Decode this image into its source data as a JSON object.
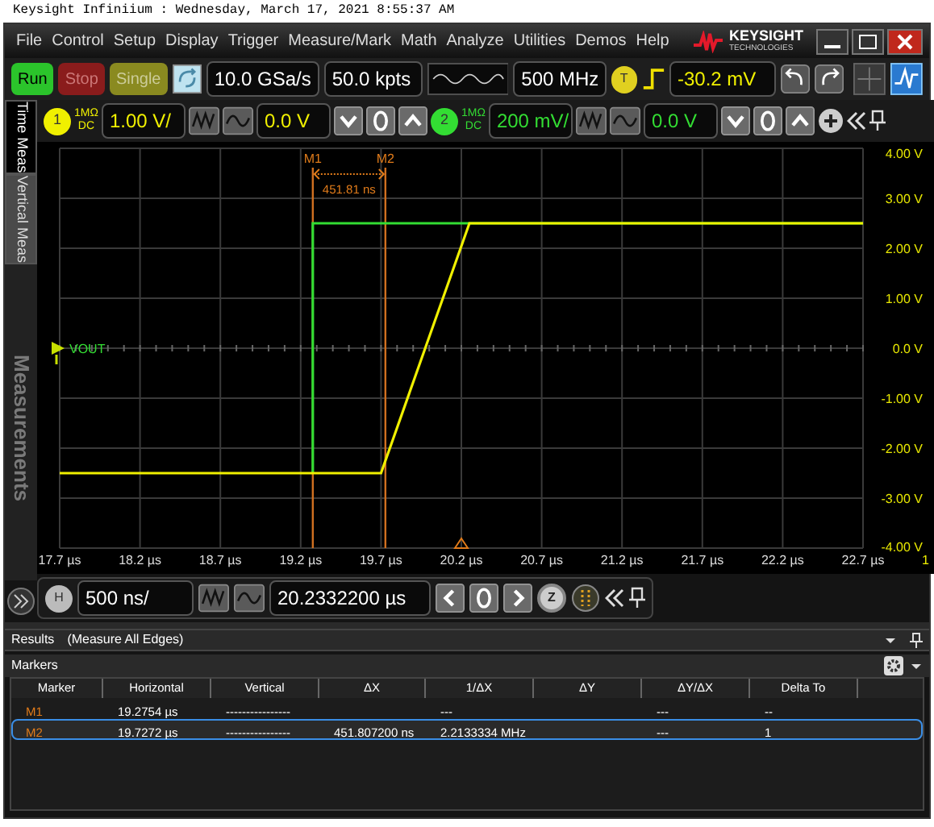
{
  "title_line": "Keysight Infiniium : Wednesday, March 17, 2021 8:55:37 AM",
  "menu": [
    "File",
    "Control",
    "Setup",
    "Display",
    "Trigger",
    "Measure/Mark",
    "Math",
    "Analyze",
    "Utilities",
    "Demos",
    "Help"
  ],
  "logo": {
    "name": "KEYSIGHT",
    "sub": "TECHNOLOGIES"
  },
  "toolbar": {
    "run": "Run",
    "stop": "Stop",
    "single": "Single",
    "sample_rate": "10.0 GSa/s",
    "memory": "50.0 kpts",
    "bandwidth": "500 MHz",
    "trigger_badge": "T",
    "trigger_level": "-30.2 mV"
  },
  "channels": [
    {
      "number": "1",
      "impedance": "1MΩ",
      "coupling": "DC",
      "scale": "1.00 V/",
      "offset": "0.0 V",
      "color": "#f0f000"
    },
    {
      "number": "2",
      "impedance": "1MΩ",
      "coupling": "DC",
      "scale": "200 mV/",
      "offset": "0.0 V",
      "color": "#33dd33"
    }
  ],
  "side_tabs": [
    {
      "label": "Time Meas",
      "selected": true
    },
    {
      "label": "Vertical Meas",
      "selected": false
    }
  ],
  "side_panel_label": "Measurements",
  "plot": {
    "channel_label": "VOUT",
    "delta_label": "451.81 ns",
    "edge_label": "1",
    "chart_data": {
      "type": "line",
      "grid": true,
      "x": [
        17.7,
        19.2754,
        19.2755,
        19.7,
        20.25,
        22.7
      ],
      "series": [
        {
          "color": "#33dd33",
          "values": [
            null,
            -2.5,
            2.5,
            2.5,
            2.5,
            2.5
          ]
        },
        {
          "color": "#f0f000",
          "values": [
            -2.5,
            -2.5,
            -2.5,
            -2.5,
            2.5,
            2.5
          ]
        }
      ],
      "ref_lines": [
        {
          "axis": "x",
          "value": 19.2754,
          "label": "M1",
          "color": "#d07020"
        },
        {
          "axis": "x",
          "value": 19.7272,
          "label": "M2",
          "color": "#d07020"
        }
      ],
      "xlim": [
        17.7,
        22.7
      ],
      "ylim": [
        -4,
        4
      ],
      "xticks": [
        {
          "value": 17.7,
          "label": "17.7 µs"
        },
        {
          "value": 18.2,
          "label": "18.2 µs"
        },
        {
          "value": 18.7,
          "label": "18.7 µs"
        },
        {
          "value": 19.2,
          "label": "19.2 µs"
        },
        {
          "value": 19.7,
          "label": "19.7 µs"
        },
        {
          "value": 20.2,
          "label": "20.2 µs"
        },
        {
          "value": 20.7,
          "label": "20.7 µs"
        },
        {
          "value": 21.2,
          "label": "21.2 µs"
        },
        {
          "value": 21.7,
          "label": "21.7 µs"
        },
        {
          "value": 22.2,
          "label": "22.2 µs"
        },
        {
          "value": 22.7,
          "label": "22.7 µs"
        }
      ],
      "yticks": [
        {
          "value": 4,
          "label": "4.00 V"
        },
        {
          "value": 3,
          "label": "3.00 V"
        },
        {
          "value": 2,
          "label": "2.00 V"
        },
        {
          "value": 1,
          "label": "1.00 V"
        },
        {
          "value": 0,
          "label": "0.0 V"
        },
        {
          "value": -1,
          "label": "-1.00 V"
        },
        {
          "value": -2,
          "label": "-2.00 V"
        },
        {
          "value": -3,
          "label": "-3.00 V"
        },
        {
          "value": -4,
          "label": "-4.00 V"
        }
      ]
    }
  },
  "horizontal": {
    "badge": "H",
    "scale": "500 ns/",
    "position": "20.2332200 µs",
    "zoom_badge": "Z"
  },
  "results": {
    "title": "Results",
    "subtitle": "(Measure All Edges)"
  },
  "markers_panel": {
    "title": "Markers",
    "columns": [
      "Marker",
      "Horizontal",
      "Vertical",
      "ΔX",
      "1/ΔX",
      "ΔY",
      "ΔY/ΔX",
      "Delta To"
    ],
    "rows": [
      {
        "marker": "M1",
        "horizontal": "19.2754 µs",
        "vertical": "----------------",
        "inv_dx": "---",
        "dy_dx": "---",
        "delta_to": "--",
        "selected": false
      },
      {
        "marker": "M2",
        "horizontal": "19.7272 µs",
        "vertical": "----------------",
        "dx": "451.807200 ns",
        "inv_dx": "2.2133334 MHz",
        "dy_dx": "---",
        "delta_to": "1",
        "selected": true
      }
    ]
  }
}
